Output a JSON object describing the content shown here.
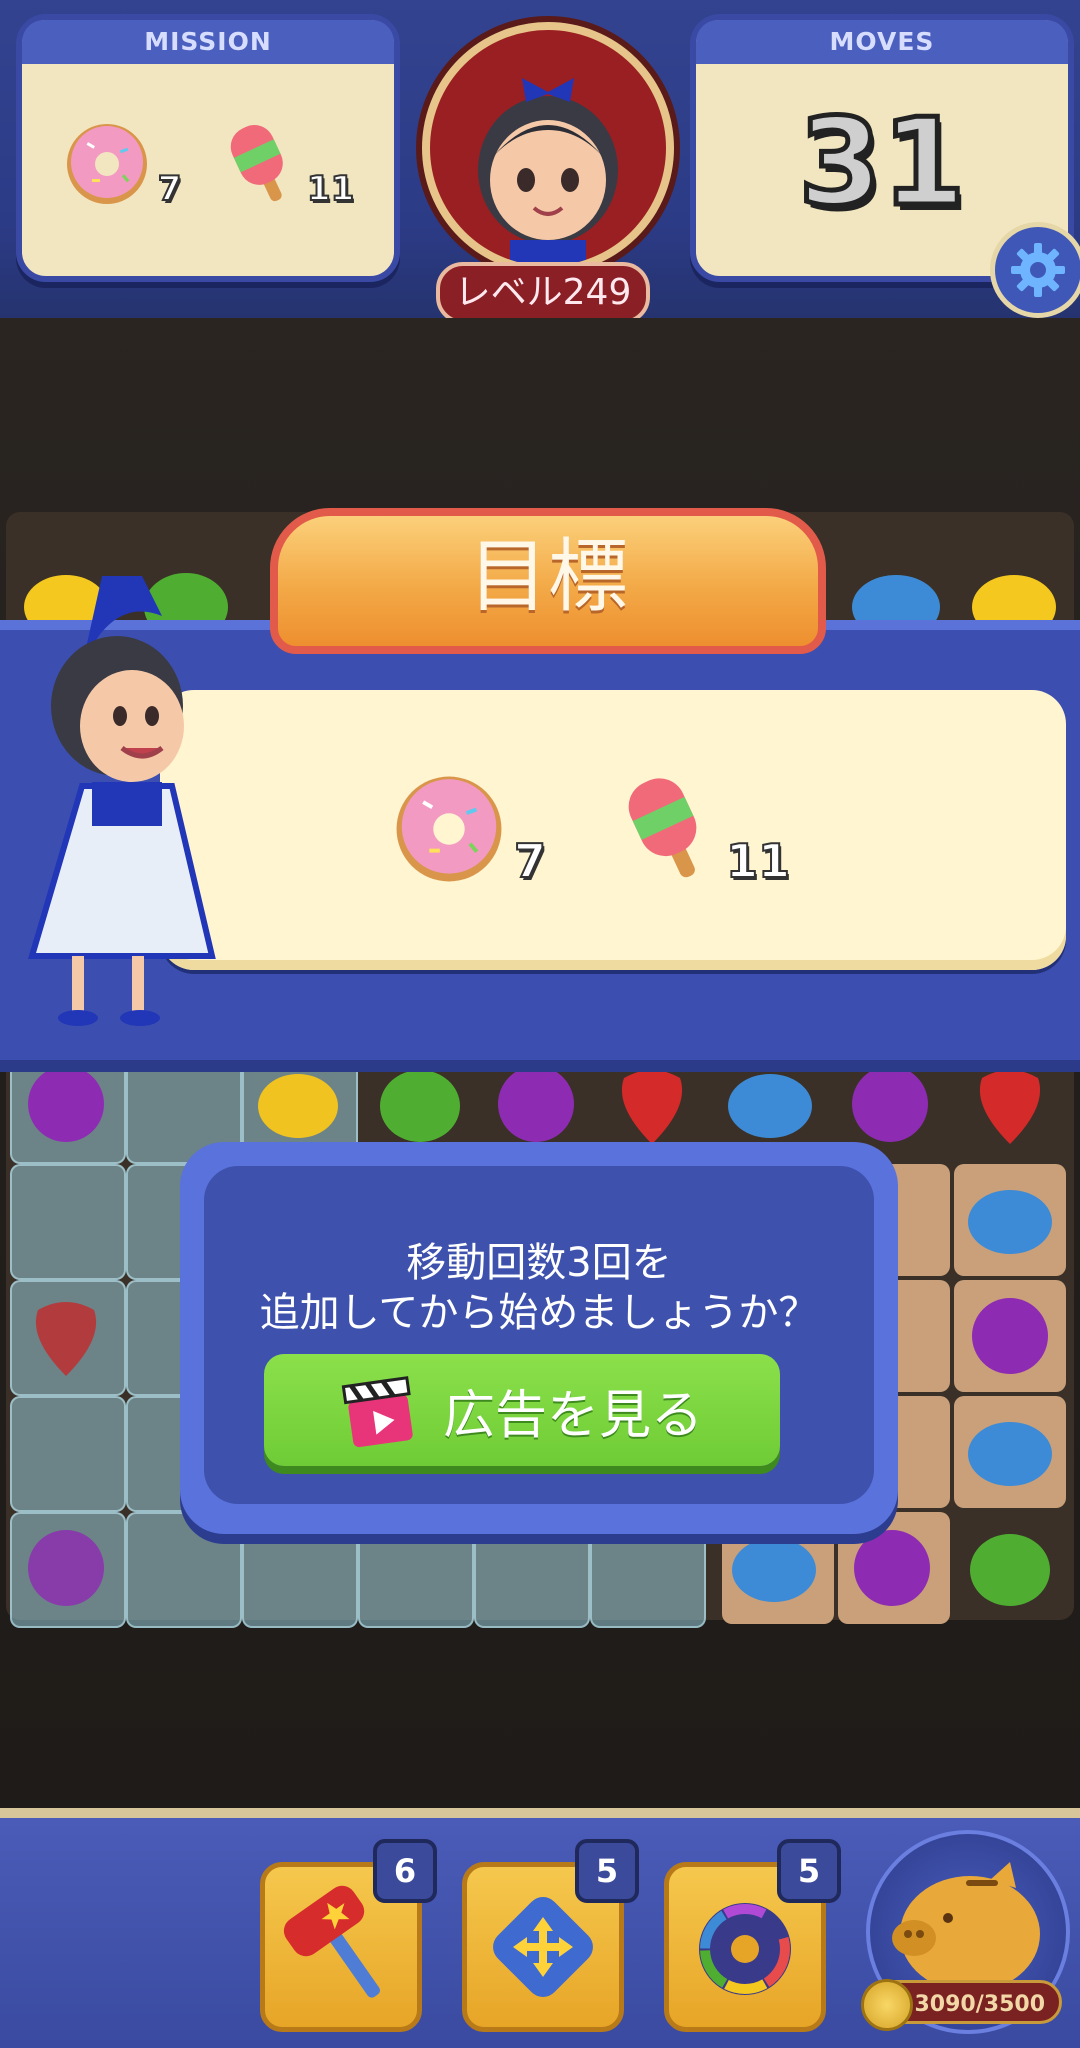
{
  "hud": {
    "mission_label": "MISSION",
    "moves_label": "MOVES",
    "moves_value": "31",
    "level": "レベル249",
    "mission_items": [
      {
        "icon": "donut-icon",
        "count": "7"
      },
      {
        "icon": "popsicle-icon",
        "count": "11"
      }
    ]
  },
  "goal": {
    "title": "目標",
    "items": [
      {
        "icon": "donut-icon",
        "count": "7"
      },
      {
        "icon": "popsicle-icon",
        "count": "11"
      }
    ]
  },
  "dialog": {
    "line1": "移動回数3回を",
    "line2": "追加してから始めましょうか？",
    "button_label": "広告を見る"
  },
  "boosters": [
    {
      "icon": "hammer-icon",
      "count": "6"
    },
    {
      "icon": "swap-arrows-icon",
      "count": "5"
    },
    {
      "icon": "rainbow-donut-icon",
      "count": "5"
    }
  ],
  "piggy_bank": {
    "coins": "3090/3500"
  },
  "colors": {
    "hud": "#33438f",
    "goal_title": "#f3a947",
    "ad_button": "#7ed440"
  }
}
